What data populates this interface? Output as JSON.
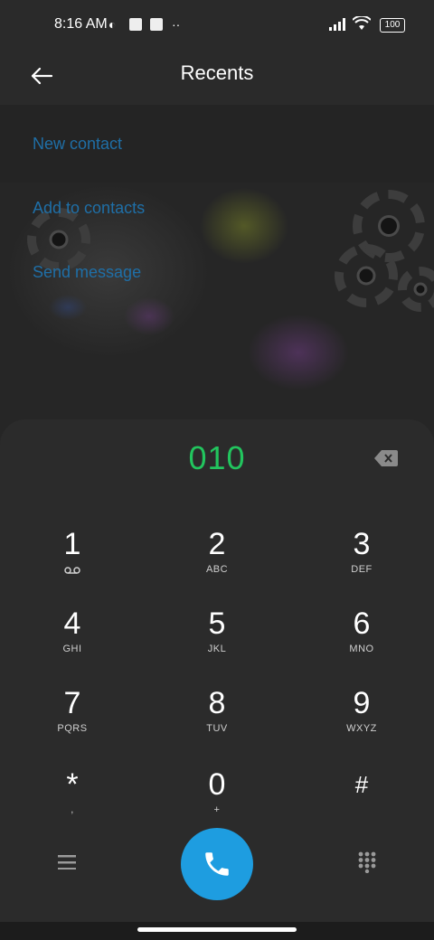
{
  "status": {
    "time": "8:16 AM",
    "battery": "100"
  },
  "appbar": {
    "title": "Recents"
  },
  "menu": {
    "new_contact": "New contact",
    "add_to_contacts": "Add to contacts",
    "send_message": "Send message"
  },
  "dialer": {
    "number": "010",
    "keys": [
      {
        "digit": "1",
        "letters": ""
      },
      {
        "digit": "2",
        "letters": "ABC"
      },
      {
        "digit": "3",
        "letters": "DEF"
      },
      {
        "digit": "4",
        "letters": "GHI"
      },
      {
        "digit": "5",
        "letters": "JKL"
      },
      {
        "digit": "6",
        "letters": "MNO"
      },
      {
        "digit": "7",
        "letters": "PQRS"
      },
      {
        "digit": "8",
        "letters": "TUV"
      },
      {
        "digit": "9",
        "letters": "WXYZ"
      },
      {
        "digit": "*",
        "letters": ","
      },
      {
        "digit": "0",
        "letters": "+"
      },
      {
        "digit": "#",
        "letters": ""
      }
    ]
  },
  "colors": {
    "accent_number": "#22c55e",
    "call_button": "#1e9de0",
    "menu_link": "#1f6fa7"
  }
}
